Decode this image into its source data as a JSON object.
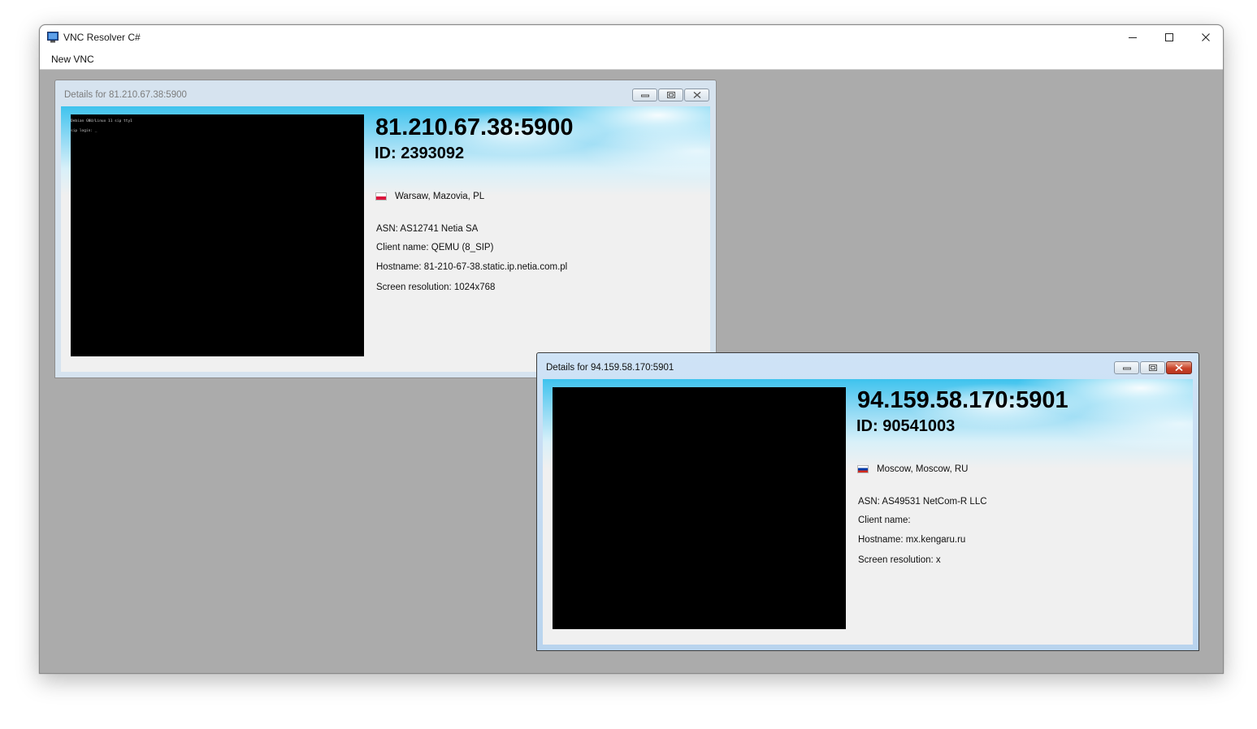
{
  "app": {
    "title": "VNC Resolver C#",
    "menu": [
      "New VNC"
    ]
  },
  "windows": [
    {
      "title": "Details for 81.210.67.38:5900",
      "state": "inactive",
      "address": "81.210.67.38:5900",
      "id": "ID: 2393092",
      "location": "Warsaw, Mazovia, PL",
      "flag_colors": [
        "#ffffff",
        "#dc143c"
      ],
      "asn": "ASN: AS12741 Netia SA",
      "client_name": "Client name: QEMU (8_SIP)",
      "hostname": "Hostname: 81-210-67-38.static.ip.netia.com.pl",
      "resolution": "Screen resolution: 1024x768",
      "terminal": [
        "Debian GNU/Linux 11 sip tty1",
        "sip login: _"
      ]
    },
    {
      "title": "Details for 94.159.58.170:5901",
      "state": "active",
      "address": "94.159.58.170:5901",
      "id": "ID: 90541003",
      "location": "Moscow, Moscow, RU",
      "flag_colors": [
        "#ffffff",
        "#0039a6",
        "#d52b1e"
      ],
      "asn": "ASN: AS49531 NetCom-R LLC",
      "client_name": "Client name:",
      "hostname": "Hostname: mx.kengaru.ru",
      "resolution": "Screen resolution: x",
      "terminal": []
    }
  ],
  "icons": {
    "app": "monitor-icon",
    "minimize": "minimize-icon",
    "maximize": "maximize-icon",
    "close": "close-icon",
    "restore": "restore-icon"
  }
}
